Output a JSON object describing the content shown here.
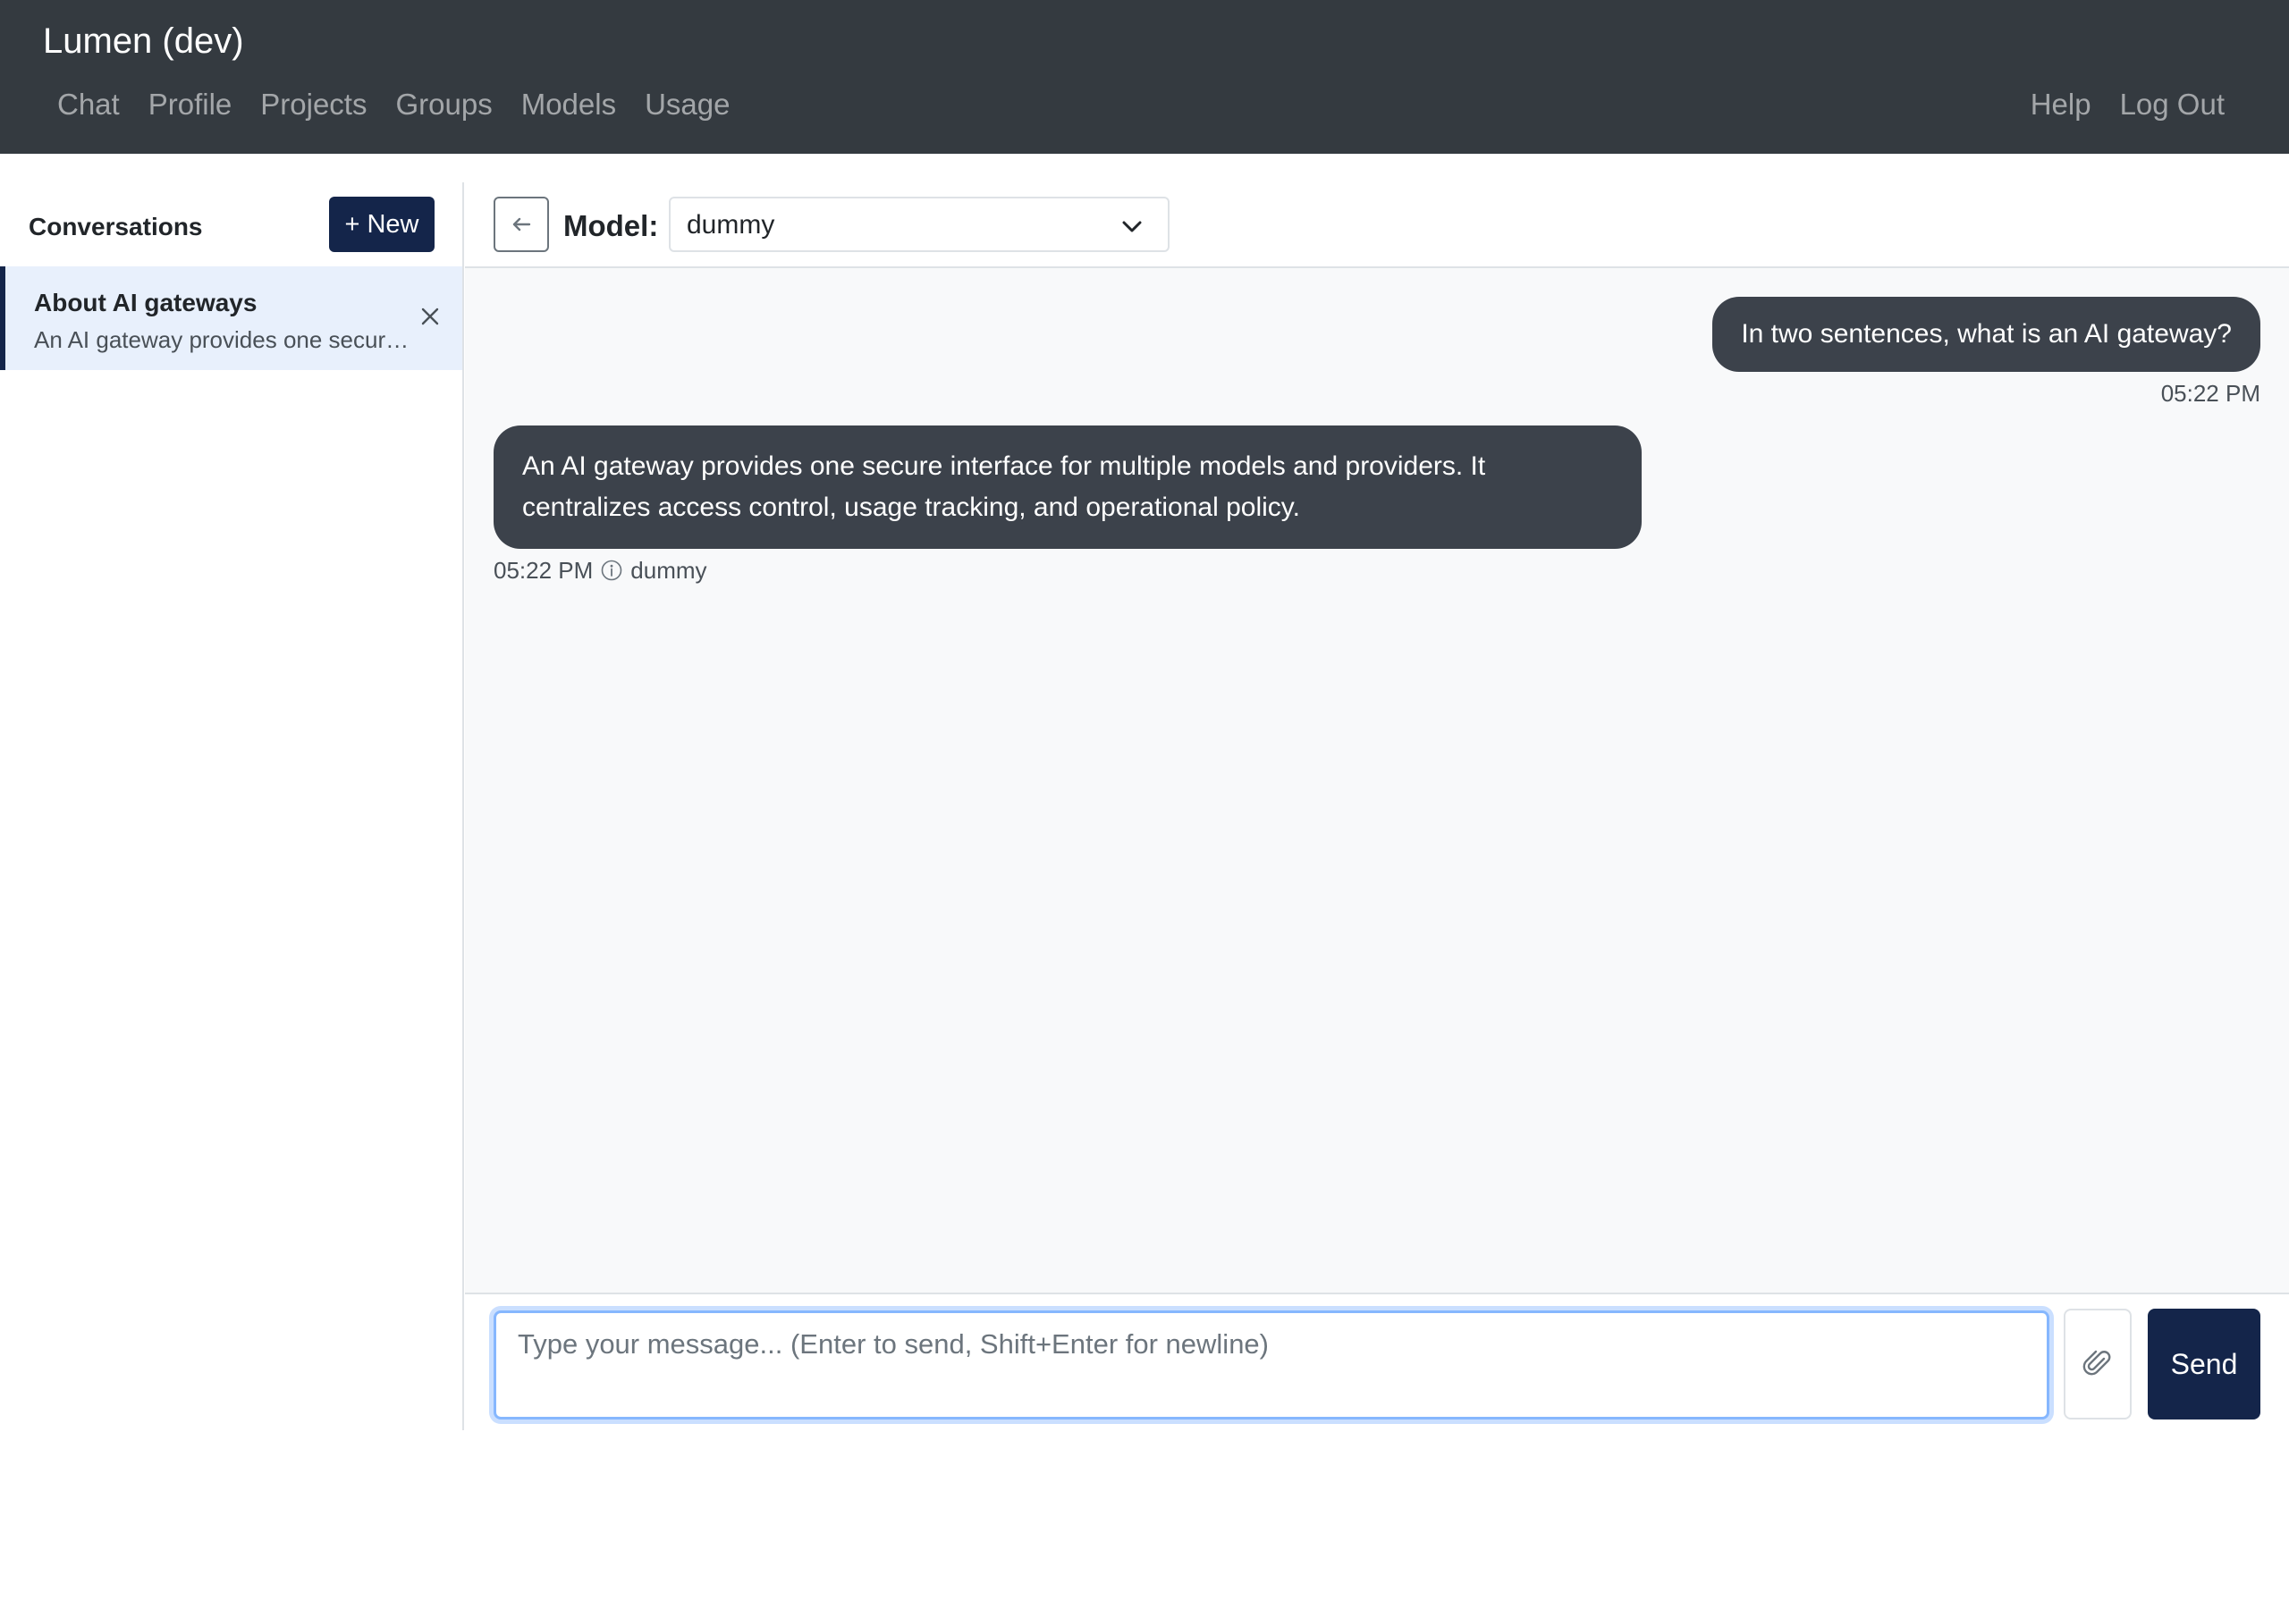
{
  "app": {
    "brand": "Lumen (dev)"
  },
  "nav": {
    "left": [
      {
        "label": "Chat"
      },
      {
        "label": "Profile"
      },
      {
        "label": "Projects"
      },
      {
        "label": "Groups"
      },
      {
        "label": "Models"
      },
      {
        "label": "Usage"
      }
    ],
    "right": [
      {
        "label": "Help"
      },
      {
        "label": "Log Out"
      }
    ]
  },
  "sidebar": {
    "title": "Conversations",
    "new_label": "+ New",
    "conversations": [
      {
        "title": "About AI gateways",
        "snippet": "An AI gateway provides one secure interface for multiple models and providers. It centralizes access control, usage tracking, and operational policy.",
        "active": true
      }
    ]
  },
  "chat": {
    "model_label": "Model:",
    "model_selected": "dummy",
    "messages": [
      {
        "role": "user",
        "text": "In two sentences, what is an AI gateway?",
        "time": "05:22 PM"
      },
      {
        "role": "assistant",
        "text": "An AI gateway provides one secure interface for multiple models and providers. It centralizes access control, usage tracking, and operational policy.",
        "time": "05:22 PM",
        "model": "dummy"
      }
    ]
  },
  "composer": {
    "placeholder": "Type your message... (Enter to send, Shift+Enter for newline)",
    "value": "",
    "send_label": "Send"
  },
  "icons": {
    "back": "arrow-left-icon",
    "model_dropdown": "chevron-down-icon",
    "conversation_close": "close-icon",
    "info": "info-circle-icon",
    "attach": "paperclip-icon"
  },
  "colors": {
    "navbar": "#343a40",
    "primary": "#14254a",
    "bubble": "#3c424b",
    "active_conversation": "#e8f0fc",
    "chat_background": "#f8f9fa",
    "input_focus": "#86b7fe"
  }
}
